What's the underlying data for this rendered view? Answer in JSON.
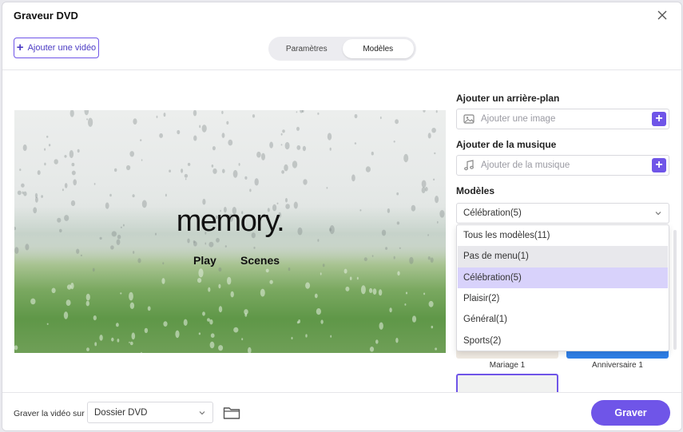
{
  "window": {
    "title": "Graveur DVD"
  },
  "toolbar": {
    "add_video_label": "Ajouter une vidéo",
    "tabs": [
      {
        "label": "Paramètres",
        "active": false
      },
      {
        "label": "Modèles",
        "active": true
      }
    ]
  },
  "preview": {
    "title": "memory.",
    "buttons": [
      "Play",
      "Scenes"
    ]
  },
  "panel": {
    "background": {
      "label": "Ajouter un arrière-plan",
      "placeholder": "Ajouter une image",
      "icon": "image-icon"
    },
    "music": {
      "label": "Ajouter de la musique",
      "placeholder": "Ajouter de la musique",
      "icon": "music-note-icon"
    },
    "templates": {
      "label": "Modèles",
      "selected": "Célébration(5)",
      "options": [
        "Tous les modèles(11)",
        "Pas de menu(1)",
        "Célébration(5)",
        "Plaisir(2)",
        "Général(1)",
        "Sports(2)"
      ],
      "hovered_index": 1,
      "selected_index": 2
    },
    "thumbnails": [
      {
        "label": "Mariage 1"
      },
      {
        "label": "Anniversaire 1"
      }
    ]
  },
  "footer": {
    "burn_to_label": "Graver la vidéo sur :",
    "destination": "Dossier DVD",
    "burn_button": "Graver"
  },
  "colors": {
    "accent": "#6f55e8",
    "selected_option": "#d8d2fb",
    "hover_option": "#e8e8ec"
  }
}
